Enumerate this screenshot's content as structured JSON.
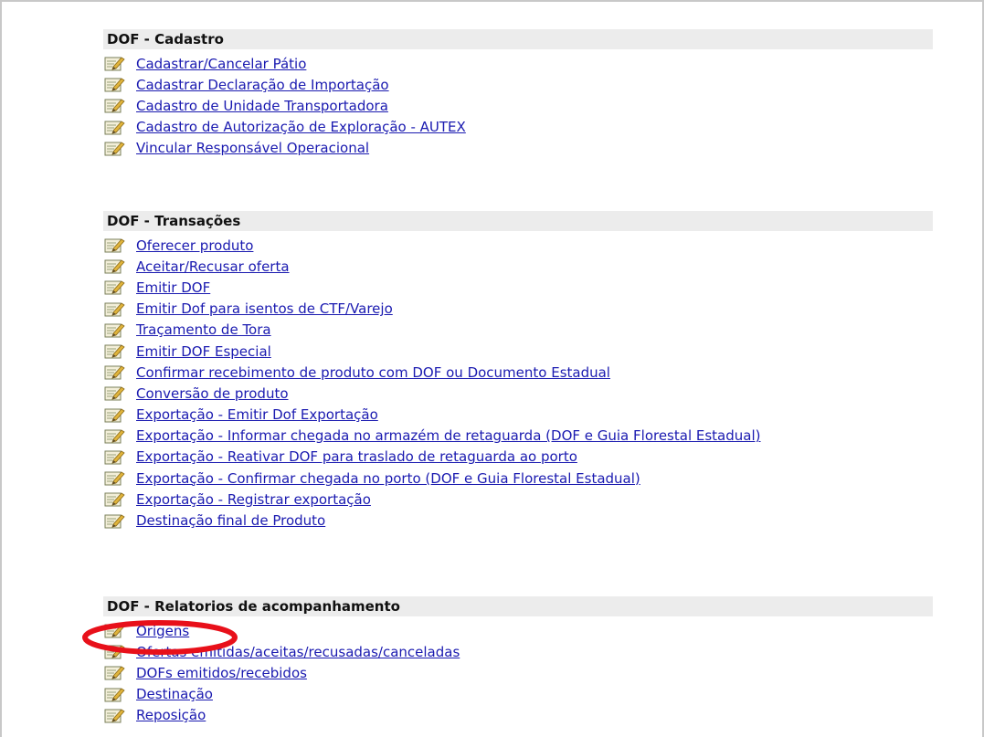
{
  "sections": [
    {
      "title": "DOF - Cadastro",
      "items": [
        {
          "label": "Cadastrar/Cancelar Pátio"
        },
        {
          "label": "Cadastrar Declaração de Importação"
        },
        {
          "label": "Cadastro de Unidade Transportadora"
        },
        {
          "label": "Cadastro de Autorização de Exploração - AUTEX"
        },
        {
          "label": "Vincular Responsável Operacional"
        }
      ]
    },
    {
      "title": "DOF - Transações",
      "items": [
        {
          "label": "Oferecer produto"
        },
        {
          "label": "Aceitar/Recusar oferta"
        },
        {
          "label": "Emitir DOF"
        },
        {
          "label": "Emitir Dof para isentos de CTF/Varejo"
        },
        {
          "label": "Traçamento de Tora"
        },
        {
          "label": "Emitir DOF Especial"
        },
        {
          "label": "Confirmar recebimento de produto com DOF ou Documento Estadual"
        },
        {
          "label": "Conversão de produto"
        },
        {
          "label": "Exportação - Emitir Dof Exportação"
        },
        {
          "label": "Exportação - Informar chegada no armazém de retaguarda (DOF e Guia Florestal Estadual)"
        },
        {
          "label": "Exportação - Reativar DOF para traslado de retaguarda ao porto"
        },
        {
          "label": "Exportação - Confirmar chegada no porto (DOF e Guia Florestal Estadual)"
        },
        {
          "label": "Exportação - Registrar exportação"
        },
        {
          "label": "Destinação final de Produto"
        }
      ]
    },
    {
      "title": "DOF - Relatorios de acompanhamento",
      "items": [
        {
          "label": "Origens"
        },
        {
          "label": "Ofertas emitidas/aceitas/recusadas/canceladas"
        },
        {
          "label": "DOFs emitidos/recebidos"
        },
        {
          "label": "Destinação"
        },
        {
          "label": "Reposição"
        }
      ]
    }
  ],
  "icon": "edit-document-icon",
  "colors": {
    "link": "#1a1ab0",
    "section_header_bg": "#ececec",
    "highlight": "#e8101a"
  },
  "highlighted_item": "Origens"
}
